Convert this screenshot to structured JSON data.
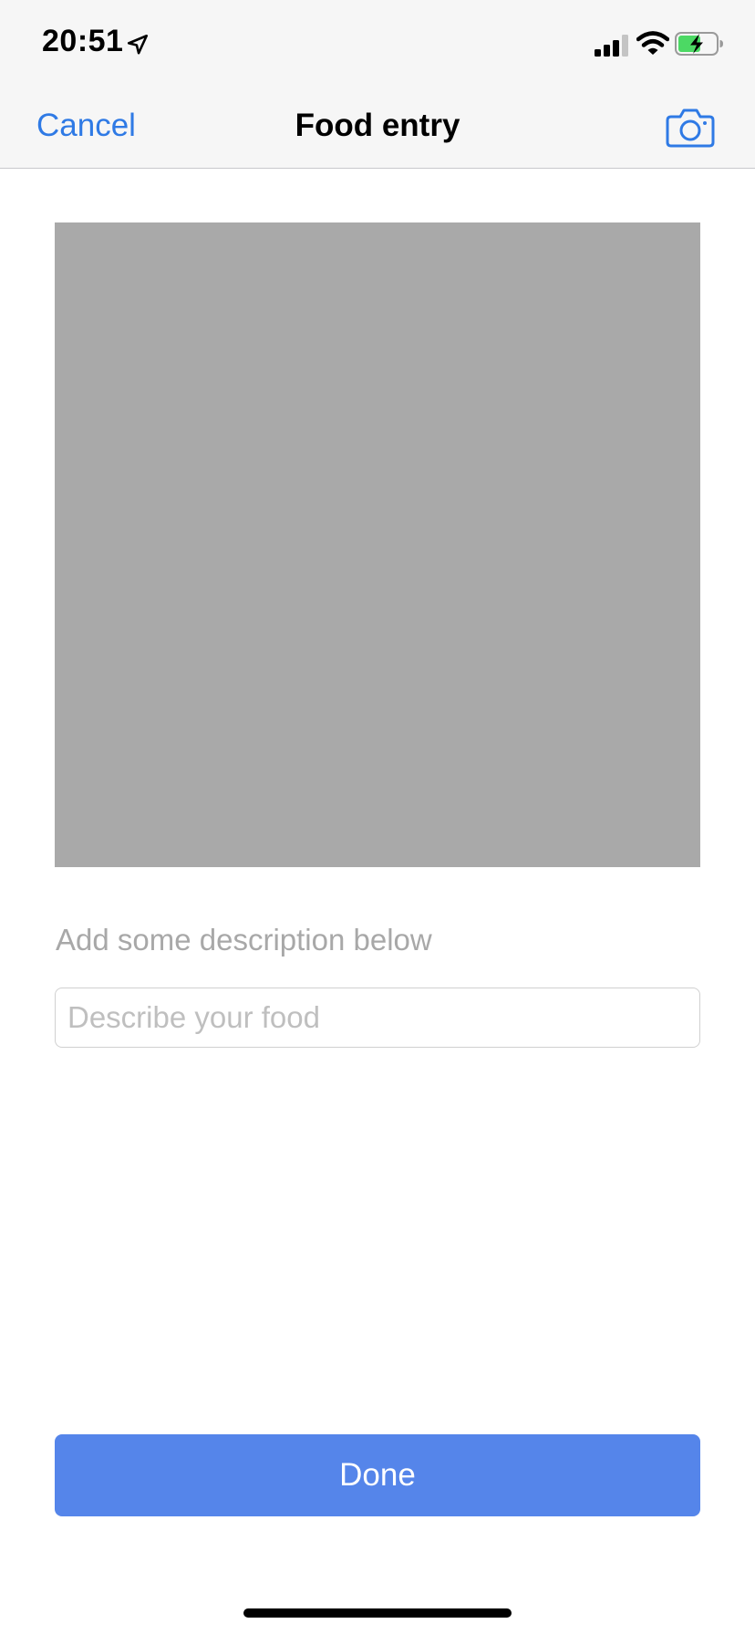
{
  "status_bar": {
    "time": "20:51",
    "icons": [
      "location-arrow-icon",
      "cellular-signal-icon",
      "wifi-icon",
      "battery-charging-icon"
    ],
    "battery_color": "#4cd964"
  },
  "nav_bar": {
    "cancel_label": "Cancel",
    "title": "Food entry",
    "camera_icon": "camera-icon",
    "accent_color": "#2f7ae5"
  },
  "photo": {
    "placeholder_color": "#a9a9a9"
  },
  "description": {
    "label": "Add some description below",
    "input_value": "",
    "placeholder": "Describe your food"
  },
  "done_button": {
    "label": "Done",
    "color": "#5585ea"
  }
}
